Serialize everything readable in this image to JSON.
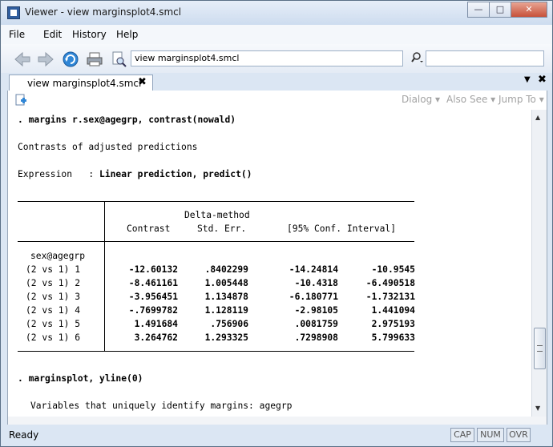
{
  "window": {
    "title": "Viewer - view marginsplot4.smcl"
  },
  "menu": [
    "File",
    "Edit",
    "History",
    "Help"
  ],
  "toolbar": {
    "address": "view marginsplot4.smcl"
  },
  "tabs": [
    {
      "label": "view marginsplot4.smcl"
    }
  ],
  "viewer_toolbar": {
    "dialog": "Dialog ▾",
    "also_see": "Also See ▾",
    "jump_to": "Jump To ▾"
  },
  "content": {
    "cmd1": ". margins r.sex@agegrp, contrast(nowald)",
    "heading": "Contrasts of adjusted predictions",
    "expr_label": "Expression   : ",
    "expr_value": "Linear prediction, predict()",
    "table": {
      "header_top": "Delta-method",
      "columns": [
        "Contrast",
        "Std. Err.",
        "[95% Conf. Interval]"
      ],
      "group": "sex@agegrp",
      "rows": [
        {
          "label": "(2 vs 1) 1",
          "contrast": "-12.60132",
          "se": ".8402299",
          "lo": "-14.24814",
          "hi": "-10.9545"
        },
        {
          "label": "(2 vs 1) 2",
          "contrast": "-8.461161",
          "se": "1.005448",
          "lo": "-10.4318",
          "hi": "-6.490518"
        },
        {
          "label": "(2 vs 1) 3",
          "contrast": "-3.956451",
          "se": "1.134878",
          "lo": "-6.180771",
          "hi": "-1.732131"
        },
        {
          "label": "(2 vs 1) 4",
          "contrast": "-.7699782",
          "se": "1.128119",
          "lo": "-2.98105",
          "hi": "1.441094"
        },
        {
          "label": "(2 vs 1) 5",
          "contrast": "1.491684",
          "se": ".756906",
          "lo": ".0081759",
          "hi": "2.975193"
        },
        {
          "label": "(2 vs 1) 6",
          "contrast": "3.264762",
          "se": "1.293325",
          "lo": ".7298908",
          "hi": "5.799633"
        }
      ]
    },
    "cmd2": ". marginsplot, yline(0)",
    "vars_line": "Variables that uniquely identify margins: agegrp"
  },
  "status": {
    "text": "Ready",
    "indicators": [
      "CAP",
      "NUM",
      "OVR"
    ]
  },
  "icons": [
    "back-arrow-icon",
    "forward-arrow-icon",
    "refresh-icon",
    "print-icon",
    "find-document-icon",
    "search-icon",
    "new-viewer-icon"
  ]
}
